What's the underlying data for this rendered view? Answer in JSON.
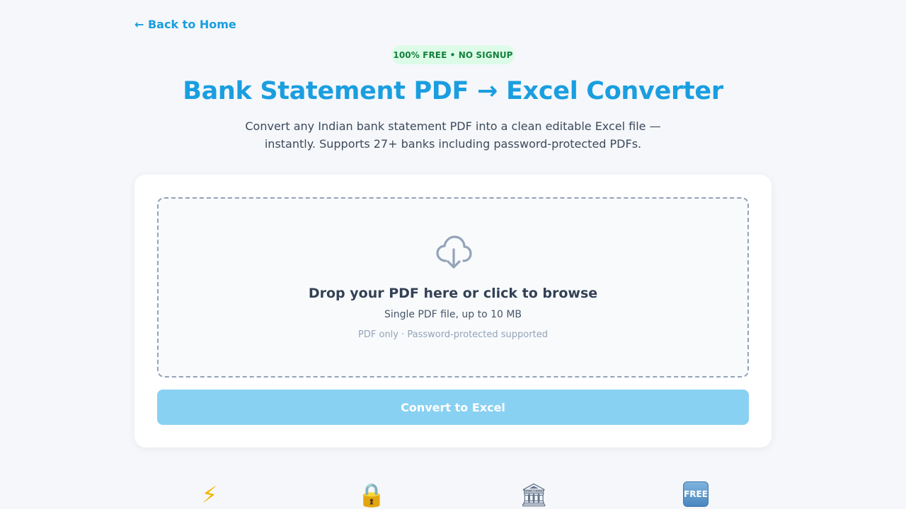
{
  "nav": {
    "back_label": "← Back to Home"
  },
  "hero": {
    "badge": "100% FREE • NO SIGNUP",
    "title": "Bank Statement PDF → Excel Converter",
    "subtitle_line1": "Convert any Indian bank statement PDF into a clean editable Excel file —",
    "subtitle_line2": "instantly. Supports 27+ banks including password-protected PDFs."
  },
  "upload": {
    "drop_title": "Drop your PDF here or click to browse",
    "drop_sub": "Single PDF file, up to 10 MB",
    "drop_hint": "PDF only · Password-protected supported",
    "convert_label": "Convert to Excel"
  },
  "features": {
    "icons": [
      "lightning-icon",
      "lock-icon",
      "bank-icon",
      "free-icon"
    ],
    "lightning_glyph": "⚡",
    "lock_glyph": "🔒",
    "bank_glyph": "🏛",
    "free_label": "FREE"
  },
  "colors": {
    "accent": "#1a9ee0",
    "badge_bg": "#dcfce7",
    "badge_text": "#15803d",
    "button_disabled": "#89d1f2",
    "background": "#f5f7fa"
  }
}
